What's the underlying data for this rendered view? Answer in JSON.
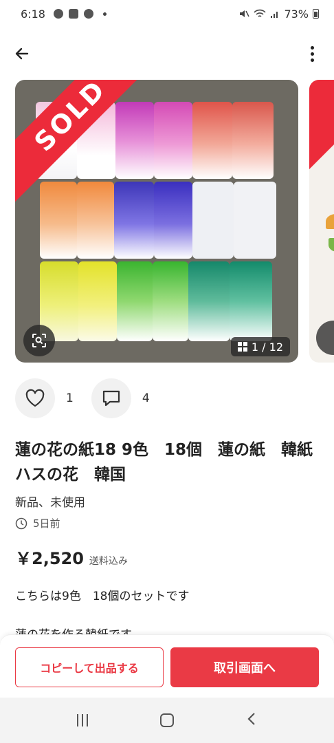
{
  "status_bar": {
    "time": "6:18",
    "battery": "73%"
  },
  "listing": {
    "sold_label": "SOLD",
    "photo_counter": "1 / 12",
    "likes": "1",
    "comments": "4",
    "title": "蓮の花の紙18 9色　18個　蓮の紙　韓紙　ハスの花　韓国",
    "condition": "新品、未使用",
    "posted": "5日前",
    "price": "￥2,520",
    "shipping": "送料込み",
    "description_line1": "こちらは9色　18個のセットです",
    "description_line2": "蓮の花を作る韓紙です"
  },
  "buttons": {
    "copy_listing": "コピーして出品する",
    "trade_screen": "取引画面へ"
  },
  "colors": {
    "accent": "#ea3a45",
    "sold_band": "#ec2b3a"
  }
}
